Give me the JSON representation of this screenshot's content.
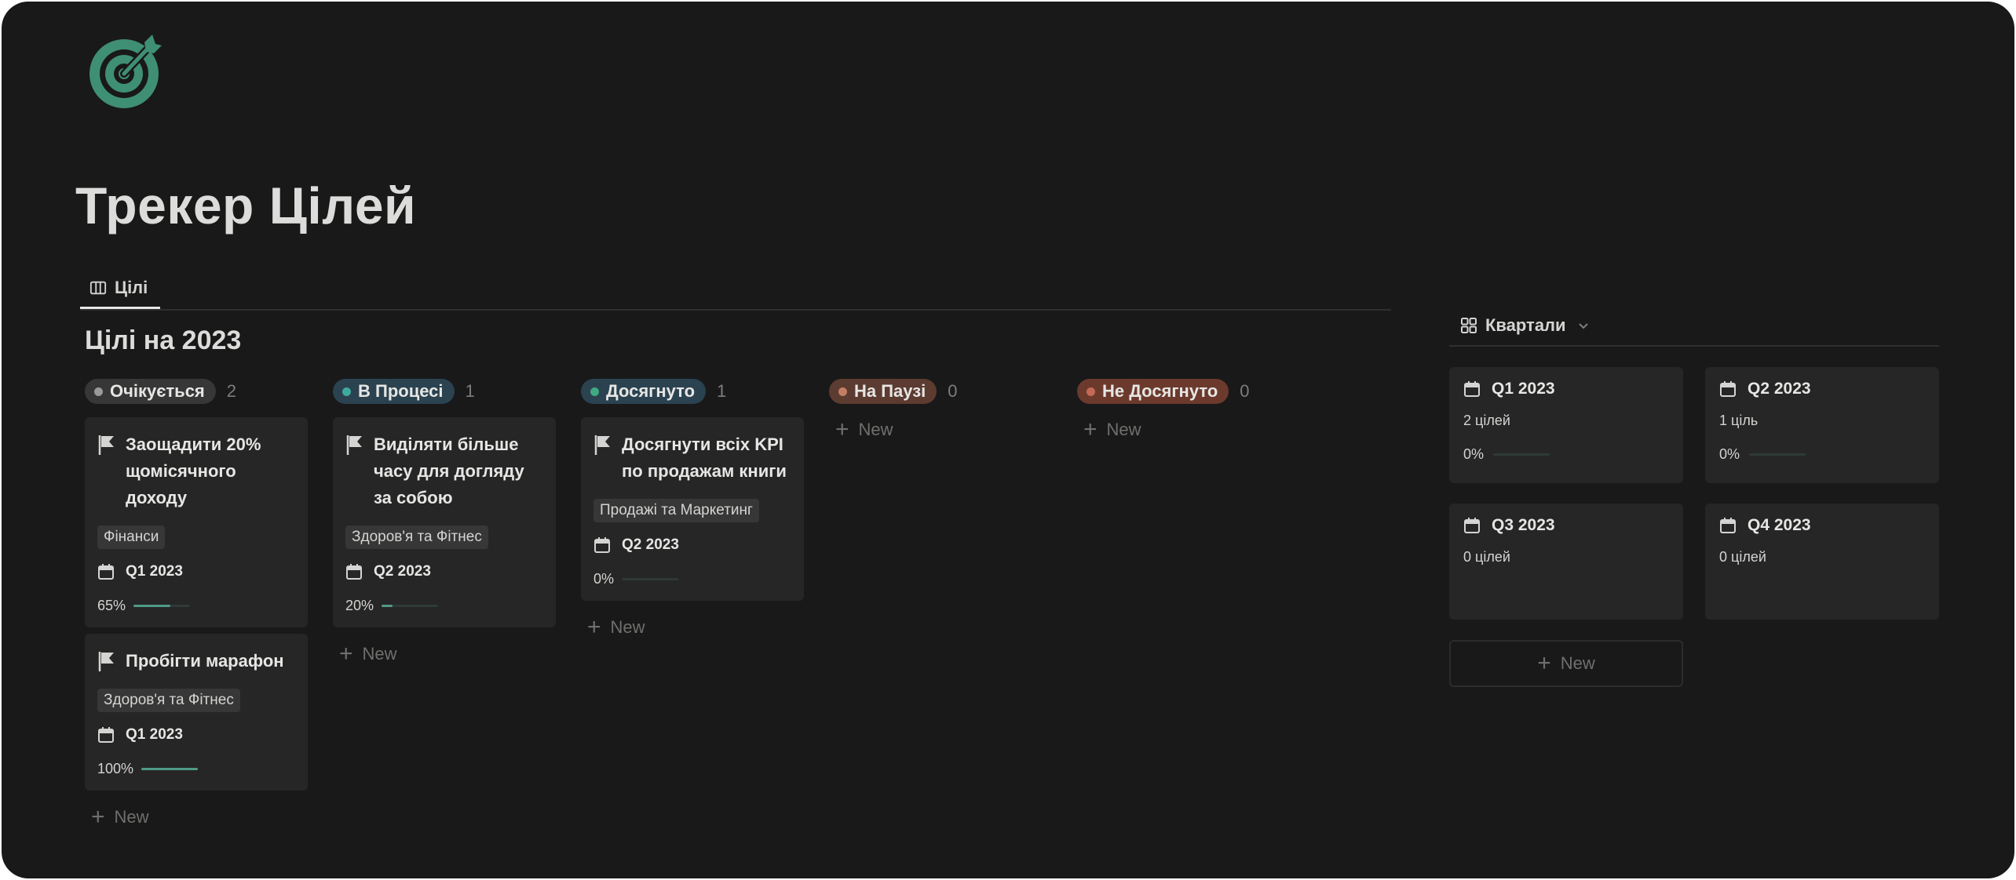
{
  "page": {
    "title": "Трекер Цілей"
  },
  "tabs": [
    {
      "label": "Цілі"
    }
  ],
  "section_title": "Цілі на 2023",
  "new_label": "New",
  "columns": [
    {
      "status": "Очікується",
      "count": "2",
      "pill_color": "#373737",
      "dot_color": "#9a9a98",
      "cards": [
        {
          "title": "Заощадити 20% щомісячного доходу",
          "tag": "Фінанси",
          "quarter": "Q1 2023",
          "progress_label": "65%",
          "progress": 0.65
        },
        {
          "title": "Пробігти марафон",
          "tag": "Здоров'я та Фітнес",
          "quarter": "Q1 2023",
          "progress_label": "100%",
          "progress": 1.0
        }
      ]
    },
    {
      "status": "В Процесі",
      "count": "1",
      "pill_color": "#2b4250",
      "dot_color": "#3fa9a0",
      "cards": [
        {
          "title": "Виділяти більше часу для догляду за собою",
          "tag": "Здоров'я та Фітнес",
          "quarter": "Q2 2023",
          "progress_label": "20%",
          "progress": 0.2
        }
      ]
    },
    {
      "status": "Досягнуто",
      "count": "1",
      "pill_color": "#2b4250",
      "dot_color": "#3fa981",
      "cards": [
        {
          "title": "Досягнути всіх KPI по продажам книги",
          "tag": "Продажі та Маркетинг",
          "quarter": "Q2 2023",
          "progress_label": "0%",
          "progress": 0.0
        }
      ]
    },
    {
      "status": "На Паузі",
      "count": "0",
      "pill_color": "#5c3b31",
      "dot_color": "#c47e64",
      "cards": []
    },
    {
      "status": "Не Досягнуто",
      "count": "0",
      "pill_color": "#6b3a2c",
      "dot_color": "#c46a55",
      "cards": []
    }
  ],
  "quarters_view": {
    "label": "Квартали",
    "cards": [
      {
        "title": "Q1 2023",
        "count": "2 цілей",
        "progress_label": "0%",
        "progress": 0.0
      },
      {
        "title": "Q2 2023",
        "count": "1 ціль",
        "progress_label": "0%",
        "progress": 0.0
      },
      {
        "title": "Q3 2023",
        "count": "0 цілей"
      },
      {
        "title": "Q4 2023",
        "count": "0 цілей"
      }
    ]
  },
  "colors": {
    "accent": "#4f9a86",
    "background": "#191919",
    "card": "#262626"
  },
  "icons": {
    "logo": "target-icon",
    "tab": "board-view-icon",
    "card": "flag-icon",
    "quarter": "calendar-icon",
    "quarters_view": "gallery-grid-icon"
  }
}
